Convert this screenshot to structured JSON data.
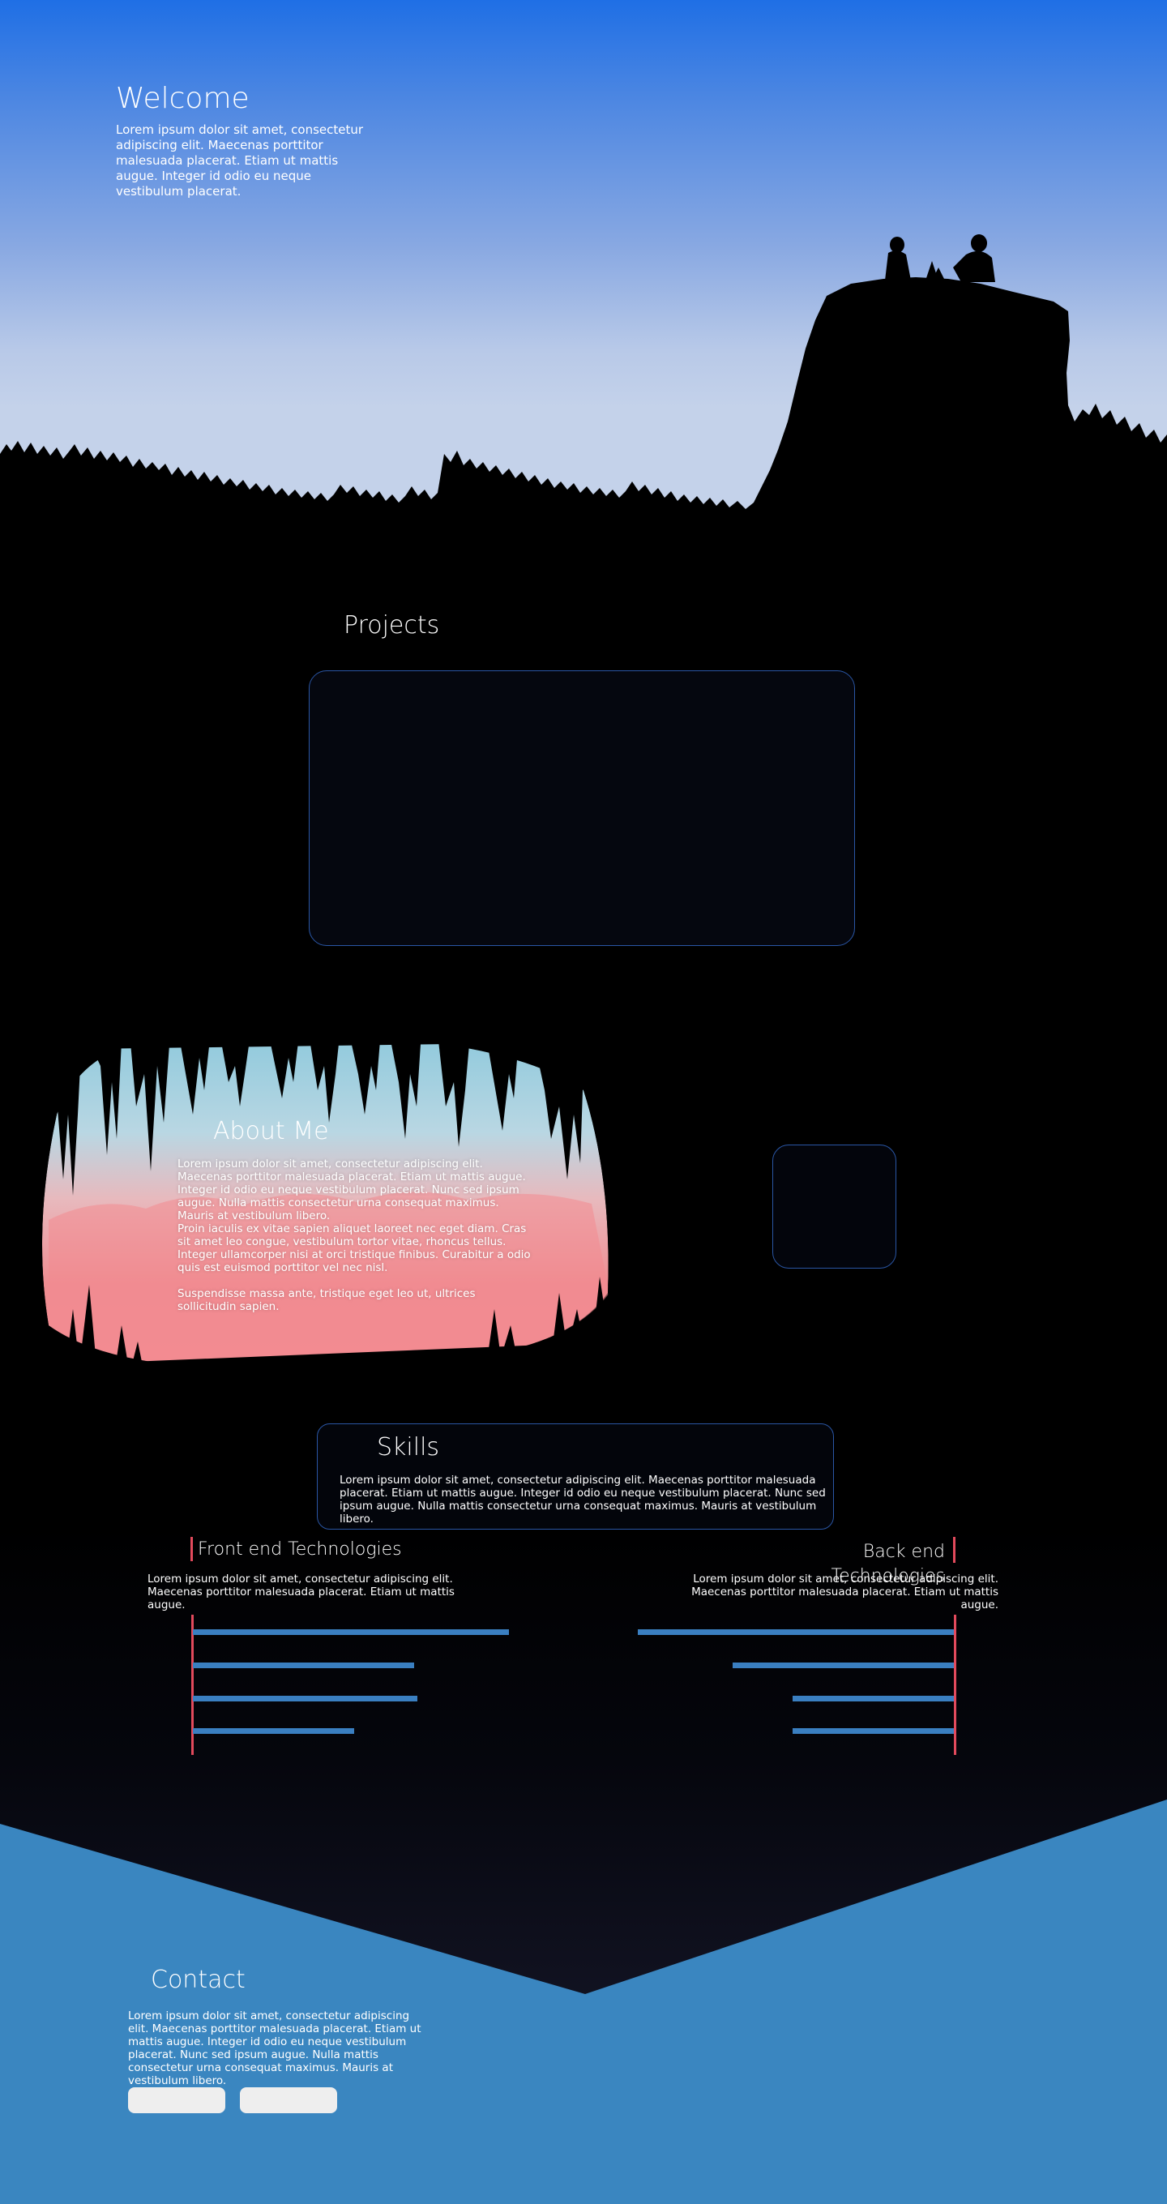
{
  "colors": {
    "accent_border": "#2a56a5",
    "skill_bar": "#3a7fc1",
    "red_marker": "#e24a5c",
    "contact_bg": "#3a86c0",
    "sky_top": "#1f6fe5",
    "sky_bottom": "#c4d2ea"
  },
  "hero": {
    "title": "Welcome",
    "text": "Lorem ipsum dolor sit amet, consectetur adipiscing elit. Maecenas porttitor malesuada placerat. Etiam ut mattis augue. Integer id odio eu neque vestibulum placerat."
  },
  "projects": {
    "title": "Projects"
  },
  "about": {
    "title": "About Me",
    "paragraphs": [
      "Lorem ipsum dolor sit amet, consectetur adipiscing elit. Maecenas porttitor malesuada placerat. Etiam ut mattis augue. Integer id odio eu neque vestibulum placerat. Nunc sed ipsum augue. Nulla mattis consectetur urna consequat maximus. Mauris at vestibulum libero.",
      "Proin iaculis ex vitae sapien aliquet laoreet nec eget diam. Cras sit amet leo congue, vestibulum tortor vitae, rhoncus tellus. Integer ullamcorper nisi at orci tristique finibus. Curabitur a odio quis est euismod porttitor vel nec nisl.",
      "Suspendisse massa ante, tristique eget leo ut, ultrices sollicitudin sapien."
    ]
  },
  "skills": {
    "title": "Skills",
    "text": "Lorem ipsum dolor sit amet, consectetur adipiscing elit. Maecenas porttitor malesuada placerat. Etiam ut mattis augue. Integer id odio eu neque vestibulum placerat. Nunc sed ipsum augue. Nulla mattis consectetur urna consequat maximus. Mauris at vestibulum libero.",
    "front_end": {
      "title": "Front end Technologies",
      "text": "Lorem ipsum dolor sit amet, consectetur adipiscing elit. Maecenas porttitor malesuada placerat. Etiam ut mattis augue.",
      "levels": [
        1.0,
        0.7,
        0.71,
        0.51
      ]
    },
    "back_end": {
      "title": "Back end Technologies",
      "text": "Lorem ipsum dolor sit amet, consectetur adipiscing elit. Maecenas porttitor malesuada placerat. Etiam ut mattis augue.",
      "levels": [
        1.0,
        0.7,
        0.51,
        0.51
      ]
    }
  },
  "contact": {
    "title": "Contact",
    "text": "Lorem ipsum dolor sit amet, consectetur adipiscing elit. Maecenas porttitor malesuada placerat. Etiam ut mattis augue. Integer id odio eu neque vestibulum placerat. Nunc sed ipsum augue. Nulla mattis consectetur urna consequat maximus. Mauris at vestibulum libero.",
    "buttons": [
      "",
      ""
    ]
  }
}
